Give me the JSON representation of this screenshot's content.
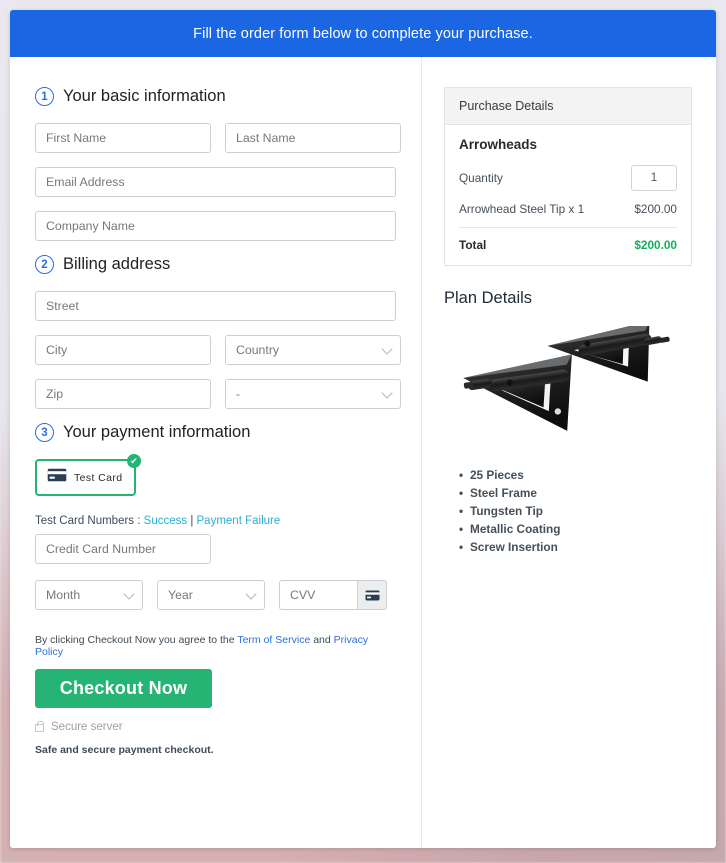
{
  "banner": {
    "text": "Fill the order form below to complete your purchase."
  },
  "steps": [
    {
      "num": "1",
      "title": "Your basic information"
    },
    {
      "num": "2",
      "title": "Billing address"
    },
    {
      "num": "3",
      "title": "Your payment information"
    }
  ],
  "basic": {
    "first_name_placeholder": "First Name",
    "last_name_placeholder": "Last Name",
    "email_placeholder": "Email Address",
    "company_placeholder": "Company Name"
  },
  "billing": {
    "street_placeholder": "Street",
    "city_placeholder": "City",
    "country_placeholder": "Country",
    "zip_placeholder": "Zip",
    "state_placeholder": "-"
  },
  "payment": {
    "method_label": "Test  Card",
    "method_icon": "credit-card-icon",
    "method_selected": true,
    "check_glyph": "✔",
    "testcards_prefix": "Test Card Numbers : ",
    "testcards_success": "Success",
    "testcards_divider": " | ",
    "testcards_failure": "Payment Failure",
    "card_number_placeholder": "Credit Card Number",
    "month_placeholder": "Month",
    "year_placeholder": "Year",
    "cvv_placeholder": "CVV",
    "cvv_icon": "credit-card-icon"
  },
  "terms": {
    "prefix": "By clicking Checkout Now you agree to the ",
    "tos": "Term of Service",
    "and": " and ",
    "privacy": "Privacy Policy"
  },
  "actions": {
    "checkout_label": "Checkout Now",
    "secure_server": "Secure server",
    "secure_icon": "lock-icon",
    "safe_note": "Safe and secure payment checkout."
  },
  "purchase": {
    "header": "Purchase Details",
    "product": "Arrowheads",
    "quantity_label": "Quantity",
    "quantity_value": "1",
    "item_label": "Arrowhead Steel Tip x 1",
    "item_price": "$200.00",
    "total_label": "Total",
    "total_value": "$200.00"
  },
  "plan": {
    "title": "Plan Details",
    "image_alt": "two-black-broadhead-arrowheads",
    "features": [
      "25 Pieces",
      "Steel Frame",
      "Tungsten Tip",
      "Metallic Coating",
      "Screw Insertion"
    ]
  },
  "colors": {
    "banner_blue": "#1a66e3",
    "step_blue": "#2a6fe0",
    "accent_green": "#25b473",
    "total_green": "#13b05c",
    "link_teal": "#2aaed4",
    "link_blue": "#2a6fe0"
  }
}
